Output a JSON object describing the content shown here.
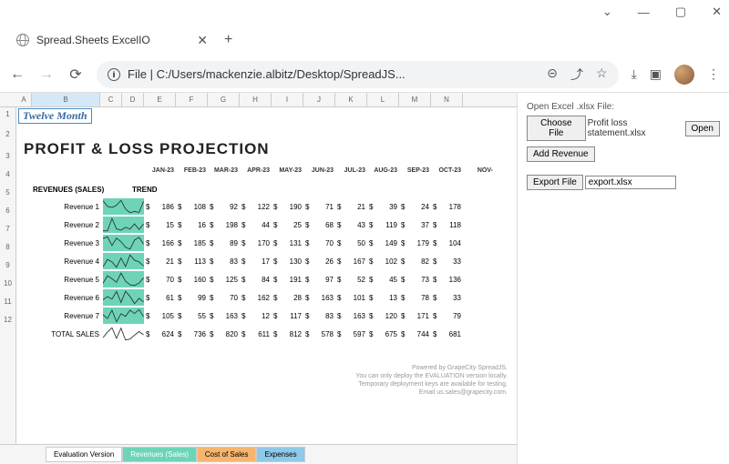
{
  "window": {
    "title": "Spread.Sheets ExcelIO"
  },
  "urlbar": {
    "prefix": "File",
    "path": "C:/Users/mackenzie.albitz/Desktop/SpreadJS..."
  },
  "spreadsheet": {
    "title_cell": "Twelve Month",
    "projection_title": "PROFIT & LOSS PROJECTION",
    "cols": [
      "A",
      "B",
      "C",
      "D",
      "E",
      "F",
      "G",
      "H",
      "I",
      "J",
      "K",
      "L",
      "M",
      "N"
    ],
    "months": [
      "JAN-23",
      "FEB-23",
      "MAR-23",
      "APR-23",
      "MAY-23",
      "JUN-23",
      "JUL-23",
      "AUG-23",
      "SEP-23",
      "OCT-23",
      "NOV-"
    ],
    "headers": {
      "revenues": "REVENUES (SALES)",
      "trend": "TREND"
    },
    "rows": [
      {
        "label": "Revenue 1",
        "values": [
          186,
          108,
          92,
          122,
          190,
          71,
          21,
          39,
          24,
          178
        ]
      },
      {
        "label": "Revenue 2",
        "values": [
          15,
          16,
          198,
          44,
          25,
          68,
          43,
          119,
          37,
          118
        ]
      },
      {
        "label": "Revenue 3",
        "values": [
          166,
          185,
          89,
          170,
          131,
          70,
          50,
          149,
          179,
          104
        ]
      },
      {
        "label": "Revenue 4",
        "values": [
          21,
          113,
          83,
          17,
          130,
          26,
          167,
          102,
          82,
          33
        ]
      },
      {
        "label": "Revenue 5",
        "values": [
          70,
          160,
          125,
          84,
          191,
          97,
          52,
          45,
          73,
          136
        ]
      },
      {
        "label": "Revenue 6",
        "values": [
          61,
          99,
          70,
          162,
          28,
          163,
          101,
          13,
          78,
          33
        ]
      },
      {
        "label": "Revenue 7",
        "values": [
          105,
          55,
          163,
          12,
          117,
          83,
          163,
          120,
          171,
          79
        ]
      }
    ],
    "total": {
      "label": "TOTAL SALES",
      "values": [
        624,
        736,
        820,
        611,
        812,
        578,
        597,
        675,
        744,
        681
      ]
    },
    "sheet_tabs": [
      "Evaluation Version",
      "Revenues (Sales)",
      "Cost of Sales",
      "Expenses"
    ],
    "eval_notice": [
      "Powered by GrapeCity SpreadJS.",
      "You can only deploy the EVALUATION version locally.",
      "Temporary deployment keys are available for testing.",
      "Email us.sales@grapecity.com."
    ]
  },
  "side": {
    "open_label": "Open Excel .xlsx File:",
    "choose_file": "Choose File",
    "filename": "Profit loss statement.xlsx",
    "open": "Open",
    "add_revenue": "Add Revenue",
    "export_file": "Export File",
    "export_name": "export.xlsx"
  }
}
